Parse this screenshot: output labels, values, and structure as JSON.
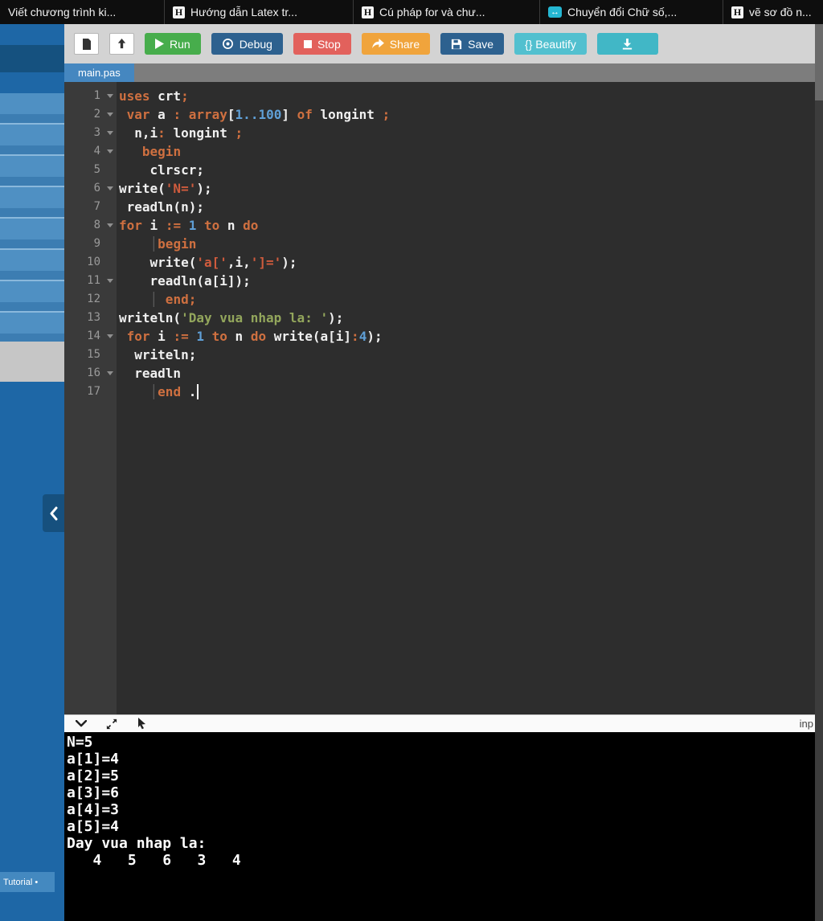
{
  "browser_tabs": [
    {
      "title": "Viết chương trình ki...",
      "favicon": "none"
    },
    {
      "title": "Hướng dẫn Latex tr...",
      "favicon": "h-logo"
    },
    {
      "title": "Cú pháp for và chư...",
      "favicon": "h-logo"
    },
    {
      "title": "Chuyển đổi Chữ số,...",
      "favicon": "swap-arrows"
    },
    {
      "title": "vẽ sơ đồ n...",
      "favicon": "h-logo"
    }
  ],
  "favicons": {
    "h": "H",
    "swap": "↔"
  },
  "toolbar": {
    "run_label": "Run",
    "debug_label": "Debug",
    "stop_label": "Stop",
    "share_label": "Share",
    "save_label": "Save",
    "beautify_label": "{} Beautify"
  },
  "editor": {
    "file_tab": "main.pas",
    "lines": [
      {
        "num": 1,
        "fold": true,
        "tokens": [
          {
            "c": "k",
            "t": "uses"
          },
          {
            "c": "p",
            "t": " crt"
          },
          {
            "c": "k",
            "t": ";"
          }
        ]
      },
      {
        "num": 2,
        "fold": true,
        "tokens": [
          {
            "c": "p",
            "t": " "
          },
          {
            "c": "k",
            "t": "var"
          },
          {
            "c": "p",
            "t": " a "
          },
          {
            "c": "k",
            "t": ":"
          },
          {
            "c": "p",
            "t": " "
          },
          {
            "c": "k",
            "t": "array"
          },
          {
            "c": "p",
            "t": "["
          },
          {
            "c": "n",
            "t": "1..100"
          },
          {
            "c": "p",
            "t": "] "
          },
          {
            "c": "k",
            "t": "of"
          },
          {
            "c": "p",
            "t": " longint "
          },
          {
            "c": "k",
            "t": ";"
          }
        ]
      },
      {
        "num": 3,
        "fold": true,
        "tokens": [
          {
            "c": "p",
            "t": "  n,i"
          },
          {
            "c": "k",
            "t": ":"
          },
          {
            "c": "p",
            "t": " longint "
          },
          {
            "c": "k",
            "t": ";"
          }
        ]
      },
      {
        "num": 4,
        "fold": true,
        "tokens": [
          {
            "c": "p",
            "t": "   "
          },
          {
            "c": "k",
            "t": "begin"
          }
        ]
      },
      {
        "num": 5,
        "fold": false,
        "tokens": [
          {
            "c": "p",
            "t": "    clrscr;"
          }
        ]
      },
      {
        "num": 6,
        "fold": true,
        "tokens": [
          {
            "c": "p",
            "t": "write("
          },
          {
            "c": "r",
            "t": "'N='"
          },
          {
            "c": "p",
            "t": ");"
          }
        ]
      },
      {
        "num": 7,
        "fold": false,
        "tokens": [
          {
            "c": "p",
            "t": " readln(n);"
          }
        ]
      },
      {
        "num": 8,
        "fold": true,
        "tokens": [
          {
            "c": "k",
            "t": "for"
          },
          {
            "c": "p",
            "t": " i "
          },
          {
            "c": "k",
            "t": ":="
          },
          {
            "c": "p",
            "t": " "
          },
          {
            "c": "n",
            "t": "1"
          },
          {
            "c": "p",
            "t": " "
          },
          {
            "c": "k",
            "t": "to"
          },
          {
            "c": "p",
            "t": " n "
          },
          {
            "c": "k",
            "t": "do"
          }
        ]
      },
      {
        "num": 9,
        "fold": false,
        "tokens": [
          {
            "c": "p",
            "t": "    "
          },
          {
            "c": "d",
            "t": "│"
          },
          {
            "c": "k",
            "t": "begin"
          }
        ]
      },
      {
        "num": 10,
        "fold": false,
        "tokens": [
          {
            "c": "p",
            "t": "    write("
          },
          {
            "c": "r",
            "t": "'a['"
          },
          {
            "c": "p",
            "t": ",i,"
          },
          {
            "c": "r",
            "t": "']='"
          },
          {
            "c": "p",
            "t": ");"
          }
        ]
      },
      {
        "num": 11,
        "fold": true,
        "tokens": [
          {
            "c": "p",
            "t": "    readln(a[i]);"
          }
        ]
      },
      {
        "num": 12,
        "fold": false,
        "tokens": [
          {
            "c": "p",
            "t": "    "
          },
          {
            "c": "d",
            "t": "│"
          },
          {
            "c": "k",
            "t": " end;"
          }
        ]
      },
      {
        "num": 13,
        "fold": false,
        "tokens": [
          {
            "c": "p",
            "t": "writeln("
          },
          {
            "c": "s",
            "t": "'Day vua nhap la: '"
          },
          {
            "c": "p",
            "t": ");"
          }
        ]
      },
      {
        "num": 14,
        "fold": true,
        "tokens": [
          {
            "c": "p",
            "t": " "
          },
          {
            "c": "k",
            "t": "for"
          },
          {
            "c": "p",
            "t": " i "
          },
          {
            "c": "k",
            "t": ":="
          },
          {
            "c": "p",
            "t": " "
          },
          {
            "c": "n",
            "t": "1"
          },
          {
            "c": "p",
            "t": " "
          },
          {
            "c": "k",
            "t": "to"
          },
          {
            "c": "p",
            "t": " n "
          },
          {
            "c": "k",
            "t": "do"
          },
          {
            "c": "p",
            "t": " write(a[i]"
          },
          {
            "c": "k",
            "t": ":"
          },
          {
            "c": "n",
            "t": "4"
          },
          {
            "c": "p",
            "t": ");"
          }
        ]
      },
      {
        "num": 15,
        "fold": false,
        "tokens": [
          {
            "c": "p",
            "t": "  writeln;"
          }
        ]
      },
      {
        "num": 16,
        "fold": true,
        "tokens": [
          {
            "c": "p",
            "t": "  readln"
          }
        ]
      },
      {
        "num": 17,
        "fold": false,
        "cursor": true,
        "tokens": [
          {
            "c": "p",
            "t": "    "
          },
          {
            "c": "d",
            "t": "│"
          },
          {
            "c": "k",
            "t": "end"
          },
          {
            "c": "p",
            "t": " ."
          }
        ]
      }
    ]
  },
  "console": {
    "lines": [
      "N=5",
      "a[1]=4",
      "a[2]=5",
      "a[3]=6",
      "a[4]=3",
      "a[5]=4",
      "Day vua nhap la: ",
      "   4   5   6   3   4"
    ],
    "input_label": "inp"
  },
  "sidebar": {
    "tutorial_label": "Tutorial •"
  },
  "colors": {
    "run": "#47ad4c",
    "debug": "#2d618f",
    "stop": "#e2615c",
    "share": "#f0a43c",
    "save": "#2d618f",
    "beautify": "#52c0cf",
    "download": "#41b7c6",
    "filetab": "#4587c0",
    "sidebar": "#1e67a6",
    "keyword": "#cf7040",
    "number": "#5f9fd6",
    "string_red": "#cf5b3d",
    "string_green": "#93a65c"
  }
}
